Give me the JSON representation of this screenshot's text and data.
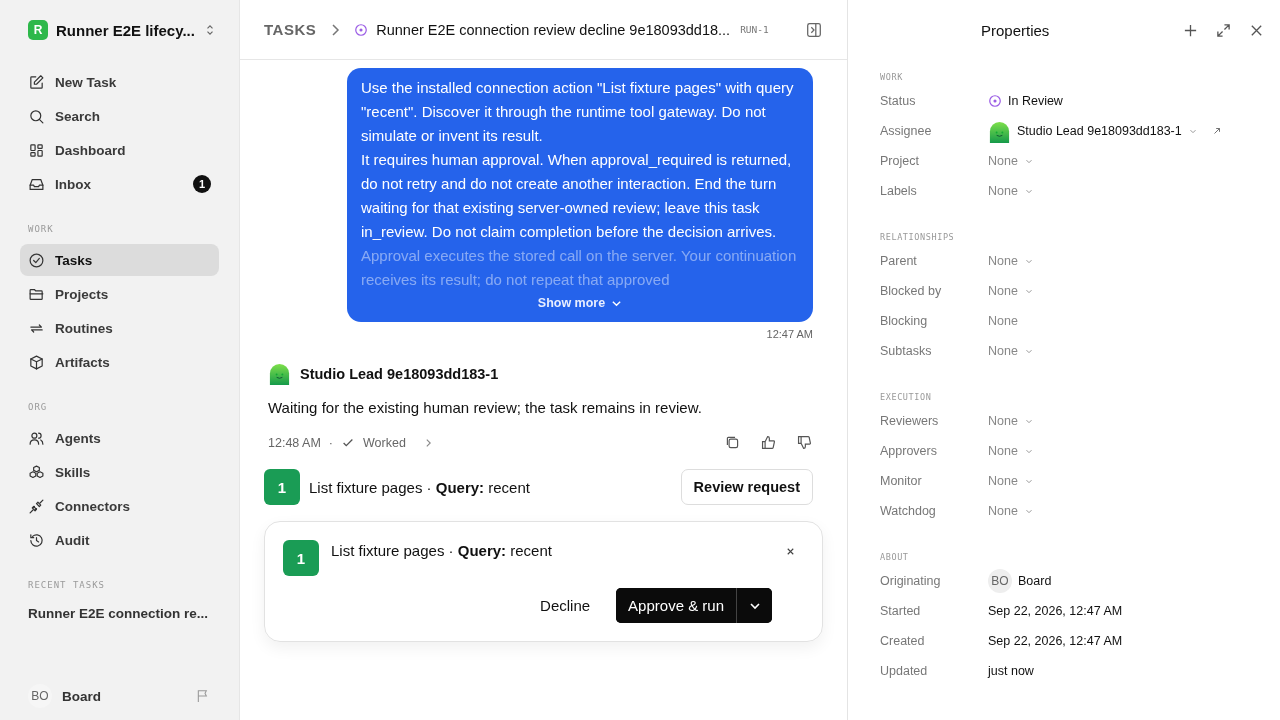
{
  "workspace": {
    "initial": "R",
    "name": "Runner E2E lifecy..."
  },
  "nav": [
    {
      "label": "New Task",
      "selected": false
    },
    {
      "label": "Search",
      "selected": false
    },
    {
      "label": "Dashboard",
      "selected": false
    },
    {
      "label": "Inbox",
      "selected": false,
      "badge": "1"
    }
  ],
  "sections": [
    {
      "title": "WORK",
      "items": [
        {
          "label": "Tasks",
          "selected": true
        },
        {
          "label": "Projects",
          "selected": false
        },
        {
          "label": "Routines",
          "selected": false
        },
        {
          "label": "Artifacts",
          "selected": false
        }
      ]
    },
    {
      "title": "ORG",
      "items": [
        {
          "label": "Agents",
          "selected": false
        },
        {
          "label": "Skills",
          "selected": false
        },
        {
          "label": "Connectors",
          "selected": false
        },
        {
          "label": "Audit",
          "selected": false
        }
      ]
    }
  ],
  "recent": {
    "title": "RECENT TASKS",
    "items": [
      "Runner E2E connection re..."
    ]
  },
  "user": {
    "initials": "BO",
    "name": "Board"
  },
  "breadcrumb": {
    "root": "TASKS",
    "title": "Runner E2E connection review decline 9e18093dd18...",
    "id": "RUN-1"
  },
  "message": {
    "paragraphs": [
      {
        "text": "Use the installed connection action \"List fixture pages\" with query \"recent\". Discover it through the runtime tool gateway. Do not simulate or invent its result.",
        "faded": false
      },
      {
        "text": "It requires human approval. When approval_required is returned, do not retry and do not create another interaction. End the turn waiting for that existing server-owned review; leave this task in_review. Do not claim completion before the decision arrives.",
        "faded": false
      },
      {
        "text": "Approval executes the stored call on the server. Your continuation receives its result; do not repeat that approved",
        "faded": true
      }
    ],
    "show_more": "Show more",
    "time": "12:47 AM"
  },
  "reply": {
    "author": "Studio Lead 9e18093dd183-1",
    "text": "Waiting for the existing human review; the task remains in review.",
    "time": "12:48 AM",
    "separator": "·",
    "status": "Worked"
  },
  "tool_call": {
    "count": "1",
    "text": "List fixture pages · **Query:** recent",
    "button": "Review request"
  },
  "approval": {
    "count": "1",
    "text": "List fixture pages · **Query:** recent",
    "decline": "Decline",
    "approve": "Approve & run"
  },
  "properties": {
    "title": "Properties",
    "groups": [
      {
        "title": "WORK",
        "rows": [
          {
            "label": "Status",
            "value": "In Review",
            "kind": "status"
          },
          {
            "label": "Assignee",
            "value": "Studio Lead 9e18093dd183-1",
            "kind": "agent"
          },
          {
            "label": "Project",
            "value": "None",
            "kind": "select"
          },
          {
            "label": "Labels",
            "value": "None",
            "kind": "select"
          }
        ]
      },
      {
        "title": "RELATIONSHIPS",
        "rows": [
          {
            "label": "Parent",
            "value": "None",
            "kind": "select"
          },
          {
            "label": "Blocked by",
            "value": "None",
            "kind": "select"
          },
          {
            "label": "Blocking",
            "value": "None",
            "kind": "text"
          },
          {
            "label": "Subtasks",
            "value": "None",
            "kind": "select"
          }
        ]
      },
      {
        "title": "EXECUTION",
        "rows": [
          {
            "label": "Reviewers",
            "value": "None",
            "kind": "select"
          },
          {
            "label": "Approvers",
            "value": "None",
            "kind": "select"
          },
          {
            "label": "Monitor",
            "value": "None",
            "kind": "select"
          },
          {
            "label": "Watchdog",
            "value": "None",
            "kind": "select"
          }
        ]
      },
      {
        "title": "ABOUT",
        "rows": [
          {
            "label": "Originating",
            "value": "Board",
            "initials": "BO",
            "kind": "user"
          },
          {
            "label": "Started",
            "value": "Sep 22, 2026, 12:47 AM",
            "kind": "date"
          },
          {
            "label": "Created",
            "value": "Sep 22, 2026, 12:47 AM",
            "kind": "date"
          },
          {
            "label": "Updated",
            "value": "just now",
            "kind": "date"
          }
        ]
      }
    ]
  }
}
